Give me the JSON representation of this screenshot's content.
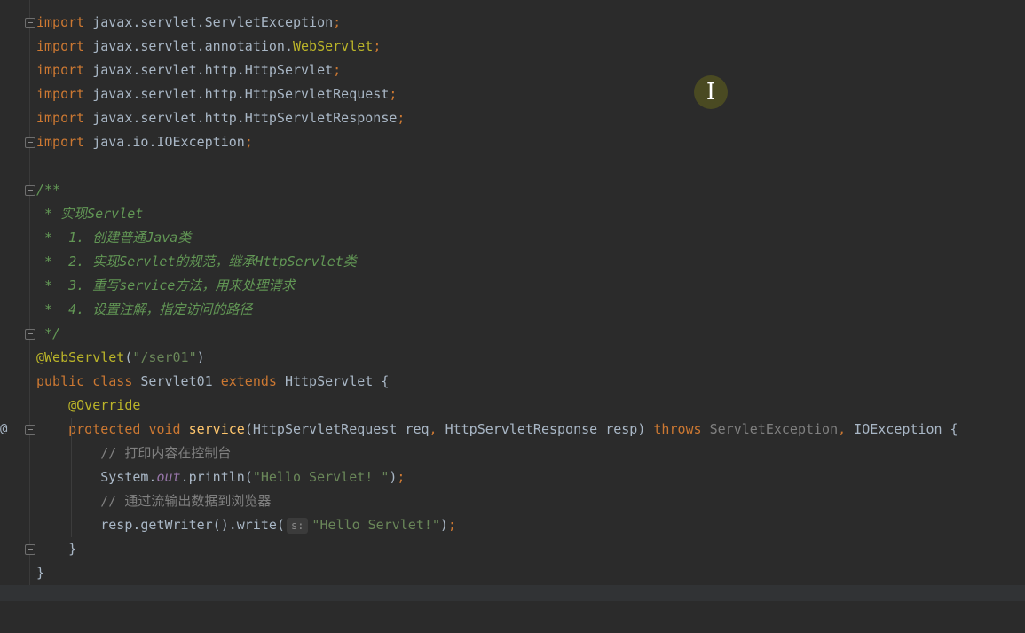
{
  "editor": {
    "lines": [
      {
        "text": "import javax.servlet.ServletException;"
      },
      {
        "text": "import javax.servlet.annotation.WebServlet;"
      },
      {
        "text": "import javax.servlet.http.HttpServlet;"
      },
      {
        "text": "import javax.servlet.http.HttpServletRequest;"
      },
      {
        "text": "import javax.servlet.http.HttpServletResponse;"
      },
      {
        "text": "import java.io.IOException;"
      },
      {
        "text": ""
      },
      {
        "text": "/**"
      },
      {
        "text": " * 实现Servlet"
      },
      {
        "text": " *  1. 创建普通Java类"
      },
      {
        "text": " *  2. 实现Servlet的规范，继承HttpServlet类"
      },
      {
        "text": " *  3. 重写service方法，用来处理请求"
      },
      {
        "text": " *  4. 设置注解，指定访问的路径"
      },
      {
        "text": " */"
      },
      {
        "text": "@WebServlet(\"/ser01\")"
      },
      {
        "text": "public class Servlet01 extends HttpServlet {"
      },
      {
        "text": "    @Override"
      },
      {
        "text": "    protected void service(HttpServletRequest req, HttpServletResponse resp) throws ServletException, IOException {"
      },
      {
        "text": "        // 打印内容在控制台"
      },
      {
        "text": "        System.out.println(\"Hello Servlet! \");"
      },
      {
        "text": "        // 通过流输出数据到浏览器"
      },
      {
        "text": "        resp.getWriter().write( s: \"Hello Servlet!\");"
      },
      {
        "text": "    }"
      },
      {
        "text": "}"
      }
    ],
    "tokens": {
      "import": "import",
      "public": "public",
      "class": "class",
      "extends": "extends",
      "protected": "protected",
      "void": "void",
      "throws": "throws",
      "semicolon": ";",
      "comma": ",",
      "override": "@Override",
      "webservlet_ann": "@WebServlet",
      "ser01": "\"/ser01\"",
      "hello1": "\"Hello Servlet! \"",
      "hello2": "\"Hello Servlet!\"",
      "hint_s": "s:",
      "servletexception": "ServletException",
      "webservlet_class": "WebServlet",
      "service": "service",
      "out": "out"
    },
    "gutter_override_marker": "@",
    "cursor_icon": "I"
  },
  "colors": {
    "background": "#2b2b2b",
    "keyword": "#cc7832",
    "string": "#6a8759",
    "annotation": "#bbb529",
    "doc_comment": "#629755",
    "line_comment": "#808080",
    "method": "#ffc66d",
    "static_field": "#9876aa",
    "default_text": "#a9b7c6"
  }
}
